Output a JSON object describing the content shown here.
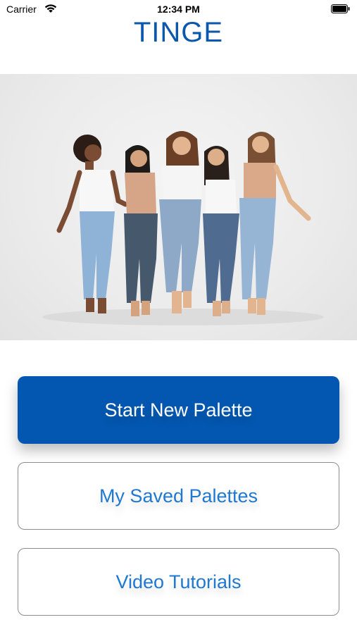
{
  "status_bar": {
    "carrier": "Carrier",
    "time": "12:34 PM",
    "wifi_icon": "wifi-icon",
    "battery_icon": "battery-icon"
  },
  "header": {
    "title": "TINGE"
  },
  "hero": {
    "image_icon": "hero-photo"
  },
  "actions": {
    "start_new_palette": "Start New Palette",
    "my_saved_palettes": "My Saved Palettes",
    "video_tutorials": "Video Tutorials"
  },
  "colors": {
    "brand_blue": "#0457b0",
    "title_blue": "#0a58ad",
    "link_blue": "#1f78d1"
  }
}
